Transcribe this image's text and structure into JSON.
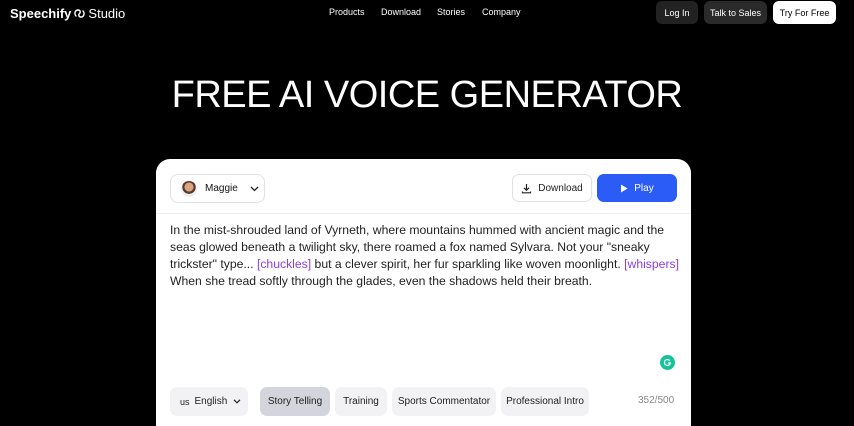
{
  "nav": {
    "logo_brand": "Speechify",
    "logo_product": "Studio",
    "menu": [
      "Products",
      "Download",
      "Stories",
      "Company"
    ],
    "login_label": "Log In",
    "sales_label": "Talk to Sales",
    "try_label": "Try For Free"
  },
  "hero": {
    "title": "FREE AI VOICE GENERATOR"
  },
  "editor": {
    "voice_name": "Maggie",
    "download_label": "Download",
    "play_label": "Play",
    "text_segments": [
      "In the mist-shrouded land of Vyrneth, where mountains hummed with ancient magic and the seas glowed beneath a twilight sky, there roamed a fox named Sylvara. Not your \"sneaky trickster\" type... ",
      "[chuckles]",
      " but a clever spirit, her fur sparkling like woven moonlight. ",
      "[whispers]",
      " When she tread softly through the glades, even the shadows held their breath."
    ],
    "language_code": "us",
    "language": "English",
    "styles": [
      "Story Telling",
      "Training",
      "Sports Commentator",
      "Professional Intro"
    ],
    "active_style": "Story Telling",
    "char_count": "352/500"
  },
  "colors": {
    "accent": "#2b5cf5",
    "tag": "#8a3df0",
    "grammarly": "#15c39a"
  }
}
